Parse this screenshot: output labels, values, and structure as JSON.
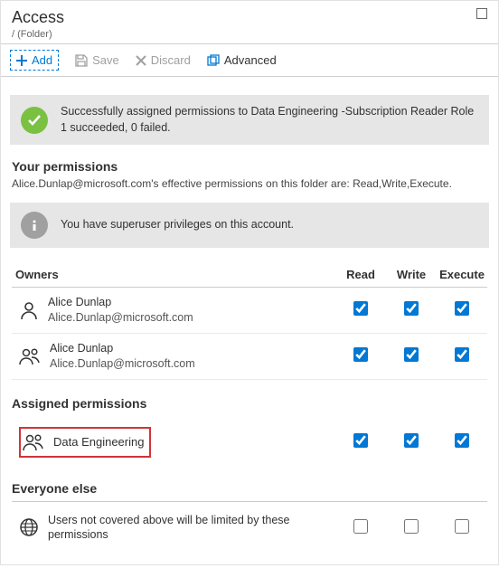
{
  "header": {
    "title": "Access",
    "breadcrumb": "/ (Folder)"
  },
  "toolbar": {
    "add_label": "Add",
    "save_label": "Save",
    "discard_label": "Discard",
    "advanced_label": "Advanced"
  },
  "success": {
    "line1": "Successfully assigned permissions to Data Engineering -Subscription Reader Role",
    "line2": "1 succeeded, 0 failed."
  },
  "your_permissions": {
    "heading": "Your permissions",
    "text": "Alice.Dunlap@microsoft.com's effective permissions on this folder are: Read,Write,Execute."
  },
  "superuser_text": "You have superuser privileges on this account.",
  "columns": {
    "read": "Read",
    "write": "Write",
    "execute": "Execute"
  },
  "owners": {
    "heading": "Owners",
    "rows": [
      {
        "name": "Alice Dunlap",
        "email": "Alice.Dunlap@microsoft.com",
        "read": true,
        "write": true,
        "execute": true,
        "group": false
      },
      {
        "name": "Alice Dunlap",
        "email": "Alice.Dunlap@microsoft.com",
        "read": true,
        "write": true,
        "execute": true,
        "group": true
      }
    ]
  },
  "assigned": {
    "heading": "Assigned permissions",
    "rows": [
      {
        "name": "Data Engineering",
        "read": true,
        "write": true,
        "execute": true,
        "highlight": true
      }
    ]
  },
  "everyone": {
    "heading": "Everyone else",
    "text": "Users not covered above will be limited by these permissions",
    "read": false,
    "write": false,
    "execute": false
  }
}
